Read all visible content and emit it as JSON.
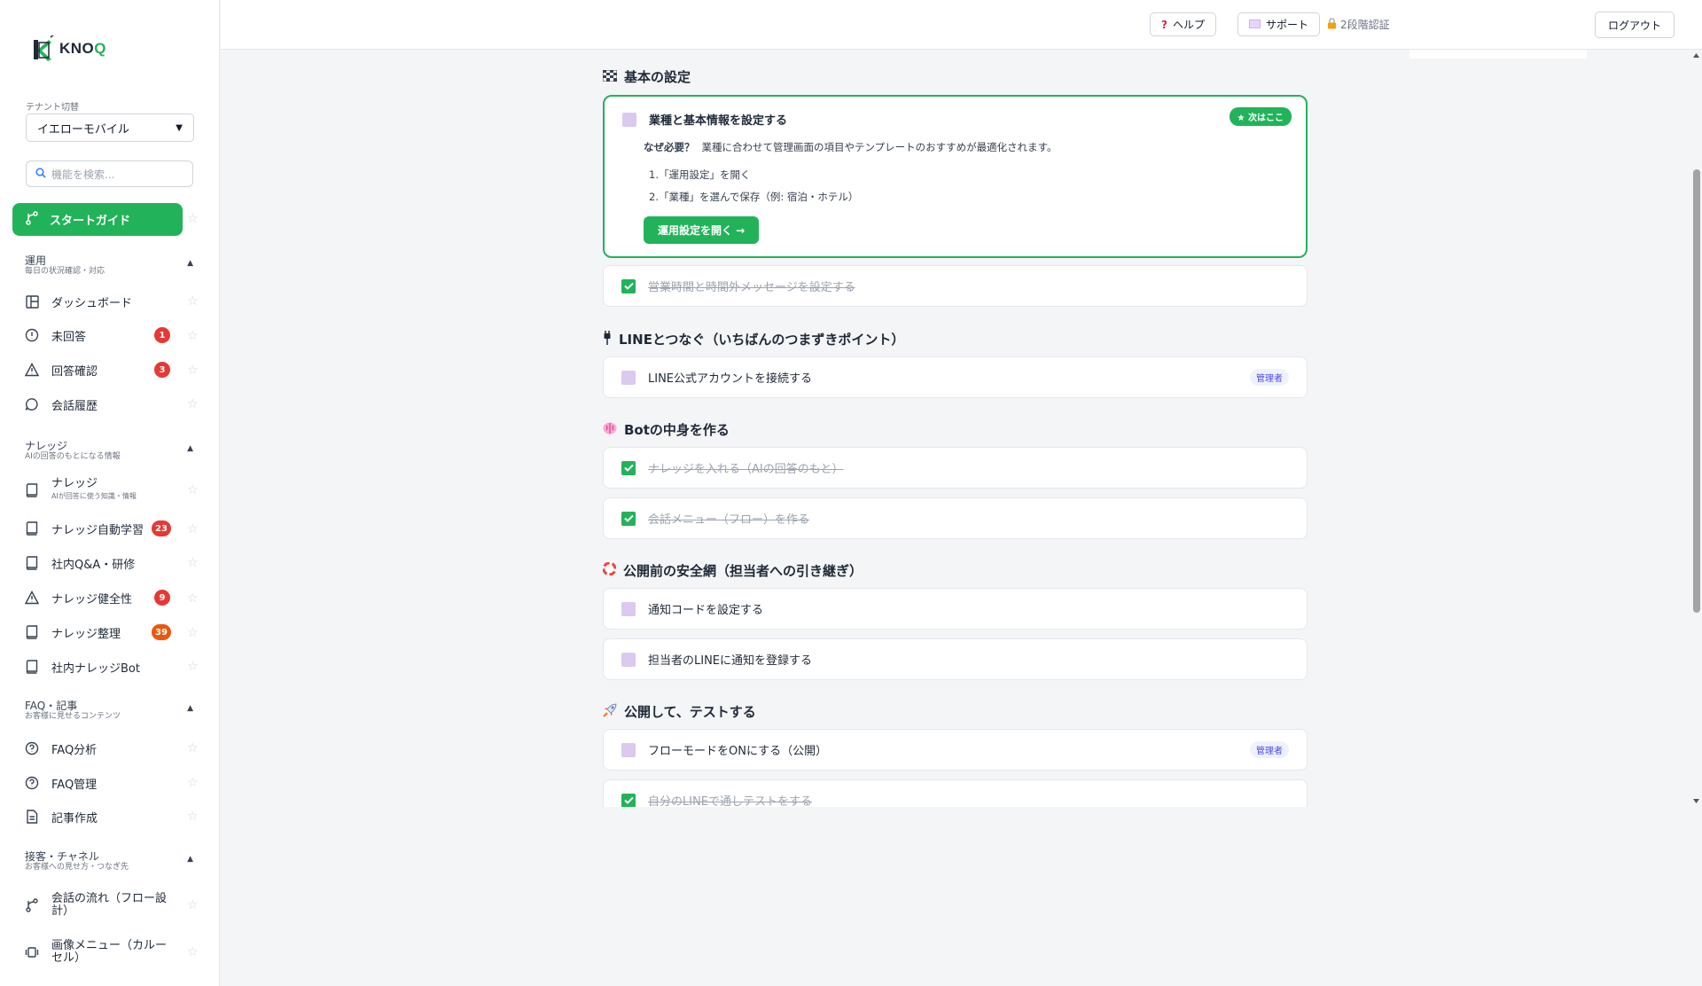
{
  "brand": {
    "logo_text": "KNO",
    "logo_text_accent": "Q"
  },
  "tenant": {
    "label": "テナント切替",
    "value": "イエローモバイル"
  },
  "search": {
    "placeholder": "機能を検索..."
  },
  "start_guide": {
    "label": "スタートガイド"
  },
  "sections": {
    "ops": {
      "title": "運用",
      "subtitle": "毎日の状況確認・対応"
    },
    "knowledge": {
      "title": "ナレッジ",
      "subtitle": "AIの回答のもとになる情報"
    },
    "faq": {
      "title": "FAQ・記事",
      "subtitle": "お客様に見せるコンテンツ"
    },
    "channel": {
      "title": "接客・チャネル",
      "subtitle": "お客様への見せ方・つなぎ先"
    }
  },
  "nav": {
    "dashboard": "ダッシュボード",
    "unanswered": "未回答",
    "unanswered_count": "1",
    "answer_check": "回答確認",
    "answer_check_count": "3",
    "history": "会話履歴",
    "knowledge": "ナレッジ",
    "knowledge_sub": "AIが回答に使う知識・情報",
    "auto_learn": "ナレッジ自動学習",
    "auto_learn_count": "23",
    "qa": "社内Q&A・研修",
    "health": "ナレッジ健全性",
    "health_count": "9",
    "organize": "ナレッジ整理",
    "organize_count": "39",
    "bot": "社内ナレッジBot",
    "faq_analysis": "FAQ分析",
    "faq_manage": "FAQ管理",
    "article": "記事作成",
    "flow": "会話の流れ（フロー設計）",
    "carousel": "画像メニュー（カルーセル）"
  },
  "topbar": {
    "help": "ヘルプ",
    "support": "サポート",
    "twofa": "2段階認証",
    "logout": "ログアウト"
  },
  "colors": {
    "accent": "#22b35a",
    "badge_red": "#e53935",
    "badge_orange": "#ea580c",
    "checkbox_off": "#dcc9ee"
  },
  "guide": {
    "cat1": "基本の設定",
    "task1": {
      "title": "業種と基本情報を設定する",
      "next": "★ 次はここ",
      "why_label": "なぜ必要？",
      "why_text": "業種に合わせて管理画面の項目やテンプレートのおすすめが最適化されます。",
      "step1": "1.「運用設定」を開く",
      "step2": "2.「業種」を選んで保存（例: 宿泊・ホテル）",
      "button": "運用設定を開く →"
    },
    "task2": "営業時間と時間外メッセージを設定する",
    "cat2": "LINEとつなぐ（いちばんのつまずきポイント）",
    "task3": "LINE公式アカウントを接続する",
    "admin": "管理者",
    "cat3": "Botの中身を作る",
    "task4": "ナレッジを入れる（AIの回答のもと）",
    "task5": "会話メニュー（フロー）を作る",
    "cat4": "公開前の安全網（担当者への引き継ぎ）",
    "task6": "通知コードを設定する",
    "task7": "担当者のLINEに通知を登録する",
    "cat5": "公開して、テストする",
    "task8": "フローモードをONにする（公開）",
    "task9": "自分のLINEで通しテストをする"
  }
}
